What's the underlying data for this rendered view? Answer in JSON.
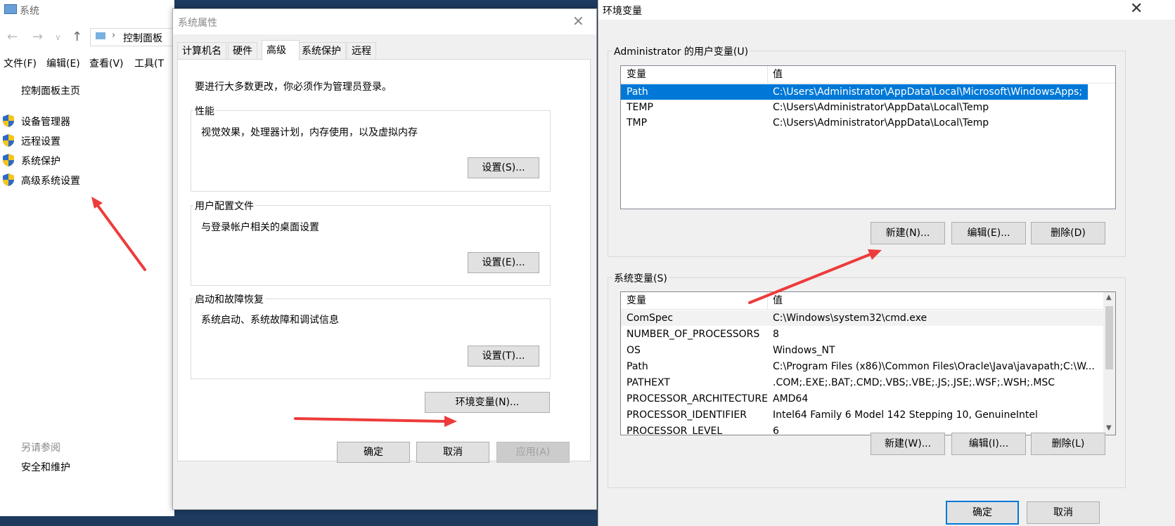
{
  "system_window": {
    "title": "系统",
    "address": "控制面板",
    "menu": [
      "文件(F)",
      "编辑(E)",
      "查看(V)",
      "工具(T"
    ],
    "home_link": "控制面板主页",
    "side_links": [
      "设备管理器",
      "远程设置",
      "系统保护",
      "高级系统设置"
    ],
    "see_also_label": "另请参阅",
    "see_also_link": "安全和维护"
  },
  "props_dialog": {
    "title": "系统属性",
    "tabs": [
      "计算机名",
      "硬件",
      "高级",
      "系统保护",
      "远程"
    ],
    "active_tab": "高级",
    "admin_note": "要进行大多数更改，你必须作为管理员登录。",
    "performance": {
      "label": "性能",
      "desc": "视觉效果，处理器计划，内存使用，以及虚拟内存",
      "button": "设置(S)..."
    },
    "user_profiles": {
      "label": "用户配置文件",
      "desc": "与登录帐户相关的桌面设置",
      "button": "设置(E)..."
    },
    "startup_recovery": {
      "label": "启动和故障恢复",
      "desc": "系统启动、系统故障和调试信息",
      "button": "设置(T)..."
    },
    "env_button": "环境变量(N)...",
    "ok": "确定",
    "cancel": "取消",
    "apply": "应用(A)"
  },
  "env_dialog": {
    "title": "环境变量",
    "user_group_label": "Administrator 的用户变量(U)",
    "col_name": "变量",
    "col_value": "值",
    "user_vars": [
      {
        "name": "Path",
        "value": "C:\\Users\\Administrator\\AppData\\Local\\Microsoft\\WindowsApps;",
        "selected": true
      },
      {
        "name": "TEMP",
        "value": "C:\\Users\\Administrator\\AppData\\Local\\Temp",
        "selected": false
      },
      {
        "name": "TMP",
        "value": "C:\\Users\\Administrator\\AppData\\Local\\Temp",
        "selected": false
      }
    ],
    "user_buttons": {
      "new": "新建(N)...",
      "edit": "编辑(E)...",
      "delete": "删除(D)"
    },
    "sys_group_label": "系统变量(S)",
    "sys_vars": [
      {
        "name": "ComSpec",
        "value": "C:\\Windows\\system32\\cmd.exe"
      },
      {
        "name": "NUMBER_OF_PROCESSORS",
        "value": "8"
      },
      {
        "name": "OS",
        "value": "Windows_NT"
      },
      {
        "name": "Path",
        "value": "C:\\Program Files (x86)\\Common Files\\Oracle\\Java\\javapath;C:\\W..."
      },
      {
        "name": "PATHEXT",
        "value": ".COM;.EXE;.BAT;.CMD;.VBS;.VBE;.JS;.JSE;.WSF;.WSH;.MSC"
      },
      {
        "name": "PROCESSOR_ARCHITECTURE",
        "value": "AMD64"
      },
      {
        "name": "PROCESSOR_IDENTIFIER",
        "value": "Intel64 Family 6 Model 142 Stepping 10, GenuineIntel"
      },
      {
        "name": "PROCESSOR_LEVEL",
        "value": "6"
      }
    ],
    "sys_buttons": {
      "new": "新建(W)...",
      "edit": "编辑(I)...",
      "delete": "删除(L)"
    },
    "ok": "确定",
    "cancel": "取消"
  },
  "colors": {
    "accent": "#0078d7",
    "annotation_arrow": "#ee3b3b",
    "shield_blue": "#2d6bc4",
    "shield_yellow": "#f5c518"
  }
}
